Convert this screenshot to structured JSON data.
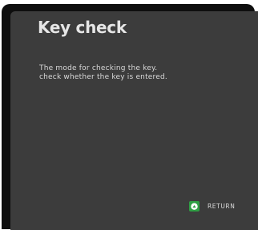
{
  "screen": {
    "title": "Key check",
    "description_lines": [
      "The mode for checking the key.",
      "check whether the key is entered."
    ]
  },
  "footer": {
    "return_label": "RETURN",
    "return_icon": "return-button-icon",
    "return_icon_color": "#2f9e44"
  },
  "colors": {
    "panel_background": "#3c3c3c",
    "frame": "#0e0e0e",
    "text": "#e6e6e6"
  }
}
